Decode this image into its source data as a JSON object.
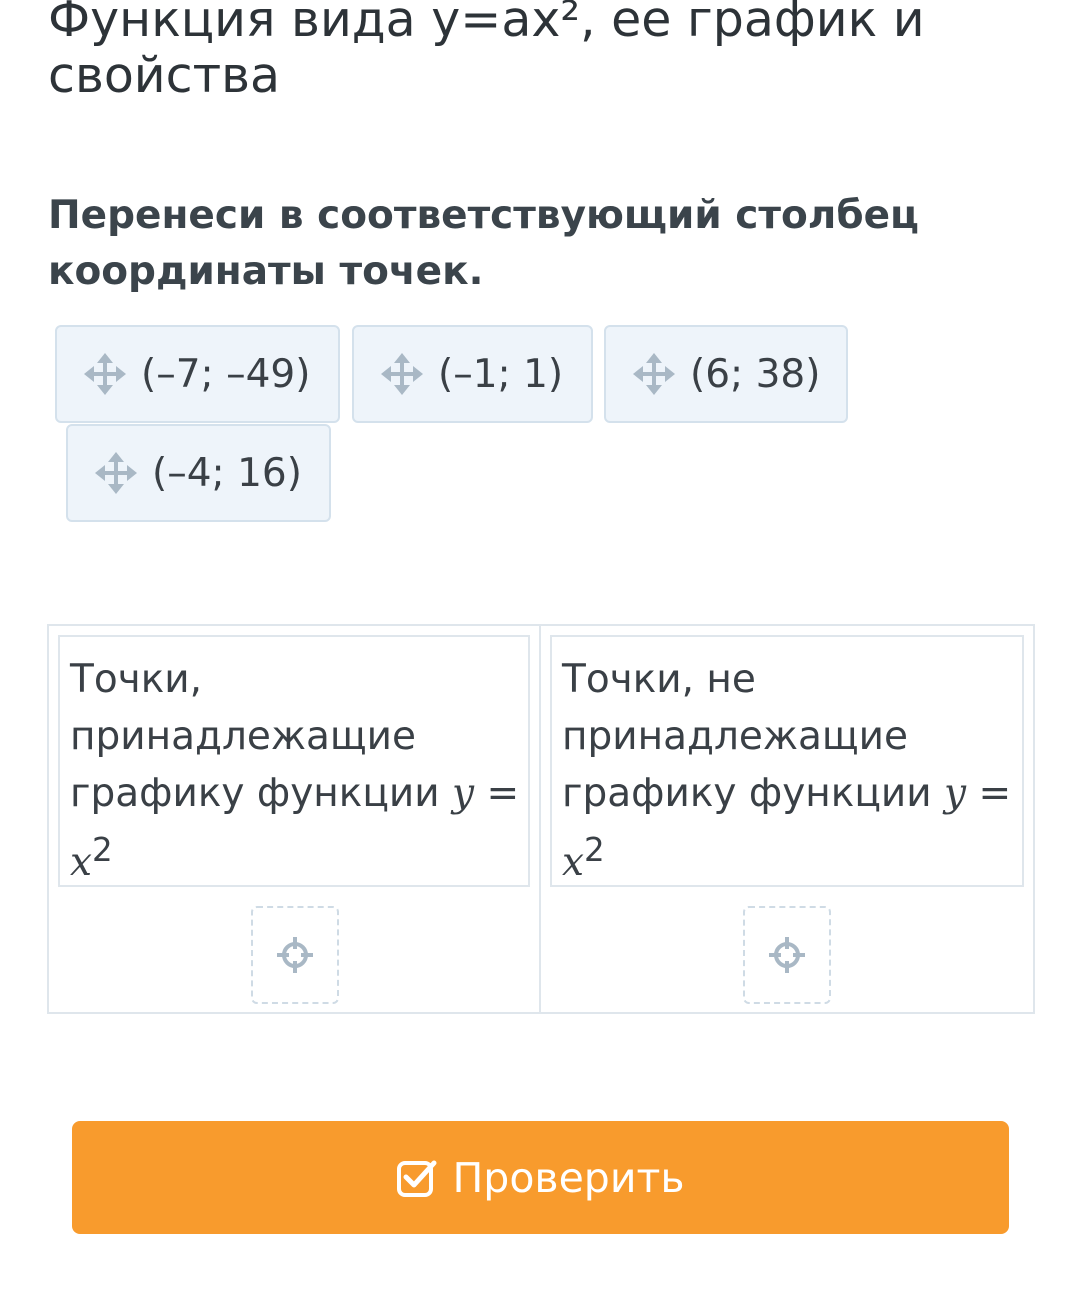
{
  "page": {
    "title": "Функция вида y=ax², ее график и свойства",
    "instruction": "Перенеси в соответствующий столбец координаты точек."
  },
  "chips": [
    {
      "label": "(–7; –49)",
      "icon": "move-icon"
    },
    {
      "label": "(–1; 1)",
      "icon": "move-icon"
    },
    {
      "label": "(6; 38)",
      "icon": "move-icon"
    },
    {
      "label": "(–4; 16)",
      "icon": "move-icon"
    }
  ],
  "columns": [
    {
      "header_text": "Точки, принадлежащие графику функции",
      "formula_y": "y",
      "formula_eq": " = ",
      "formula_x": "x",
      "formula_exp": "2",
      "drop_icon": "target-icon"
    },
    {
      "header_text": "Точки, не принадлежащие графику функции",
      "formula_y": "y",
      "formula_eq": " = ",
      "formula_x": "x",
      "formula_exp": "2",
      "drop_icon": "target-icon"
    }
  ],
  "actions": {
    "check_label": "Проверить",
    "check_icon": "checkbox-check-icon"
  },
  "colors": {
    "chip_bg": "#eef4fa",
    "chip_border": "#d4e1ec",
    "icon_gray": "#a9b8c5",
    "accent_orange": "#f89b2d"
  }
}
